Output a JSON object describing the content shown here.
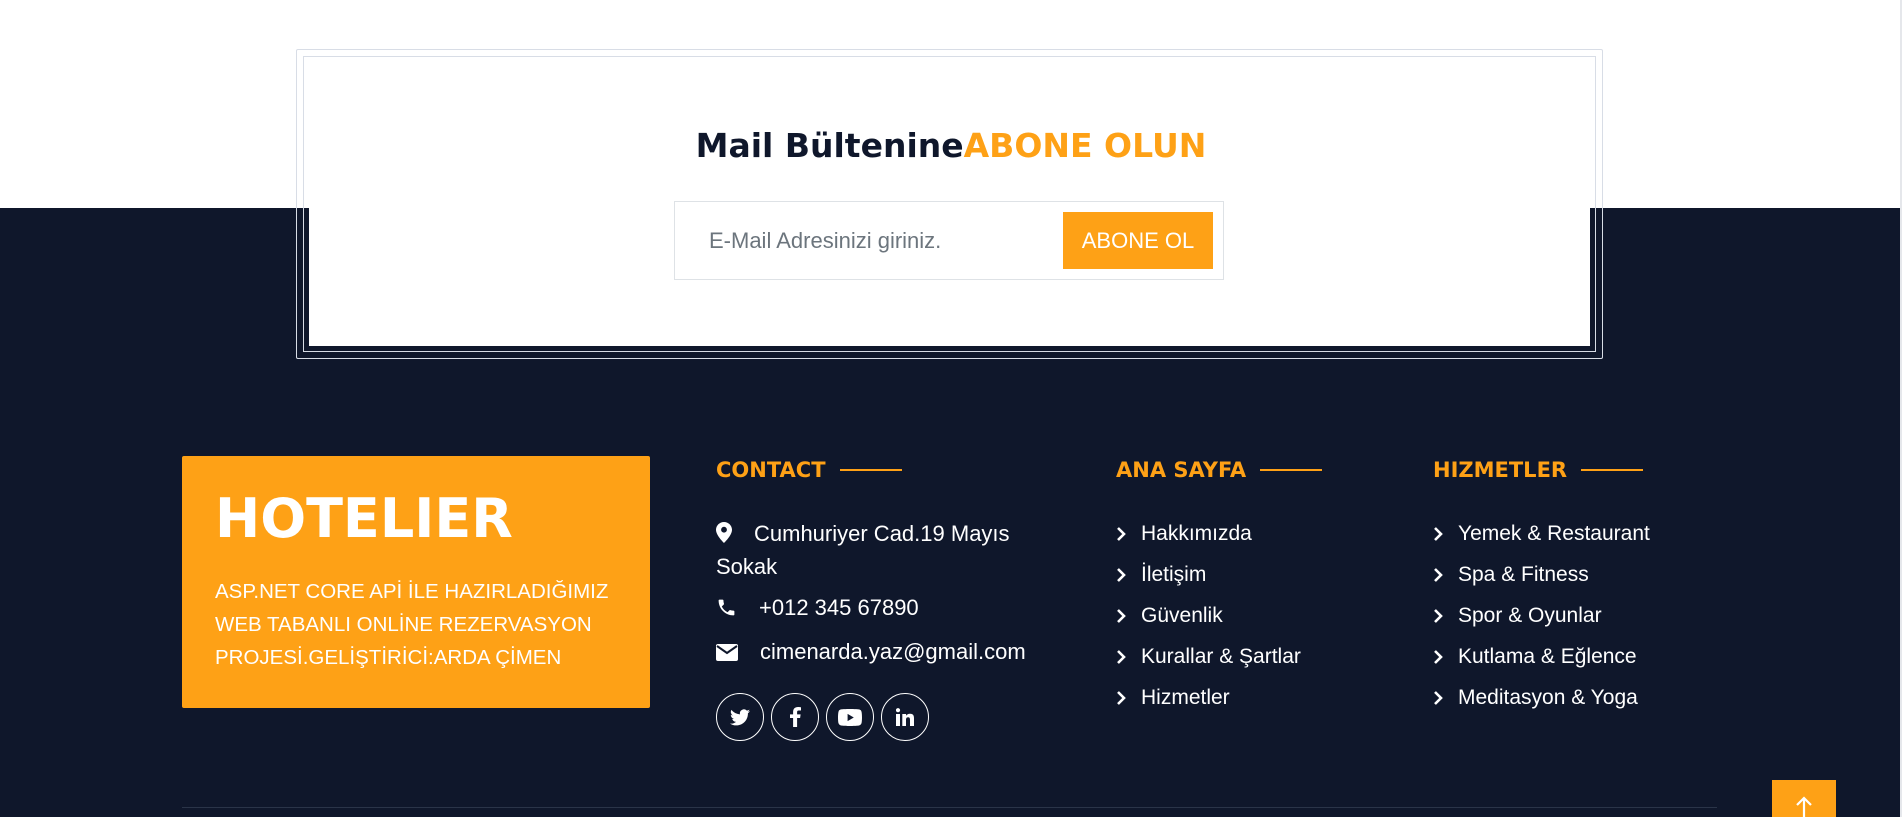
{
  "newsletter": {
    "title_main": "Mail Bültenine",
    "title_accent": "ABONE OLUN",
    "email_placeholder": "E-Mail Adresinizi giriniz.",
    "email_value": "",
    "subscribe_label": "ABONE OL"
  },
  "brand": {
    "title": "HOTELIER",
    "description": "ASP.NET CORE APİ İLE HAZIRLADIĞIMIZ WEB TABANLI ONLİNE REZERVASYON PROJESİ.GELİŞTİRİCİ:ARDA ÇİMEN"
  },
  "contact": {
    "heading": "CONTACT",
    "address": "Cumhuriyer Cad.19 Mayıs Sokak",
    "phone": "+012 345 67890",
    "email": "cimenarda.yaz@gmail.com",
    "socials": [
      "twitter-icon",
      "facebook-icon",
      "youtube-icon",
      "linkedin-icon"
    ]
  },
  "homepage": {
    "heading": "ANA SAYFA",
    "links": [
      "Hakkımızda",
      "İletişim",
      "Güvenlik",
      "Kurallar & Şartlar",
      "Hizmetler"
    ]
  },
  "services": {
    "heading": "HIZMETLER",
    "links": [
      "Yemek & Restaurant",
      "Spa & Fitness",
      "Spor & Oyunlar",
      "Kutlama & Eğlence",
      "Meditasyon & Yoga"
    ]
  },
  "colors": {
    "accent": "#fea116",
    "dark": "#0f172b",
    "white": "#ffffff"
  }
}
